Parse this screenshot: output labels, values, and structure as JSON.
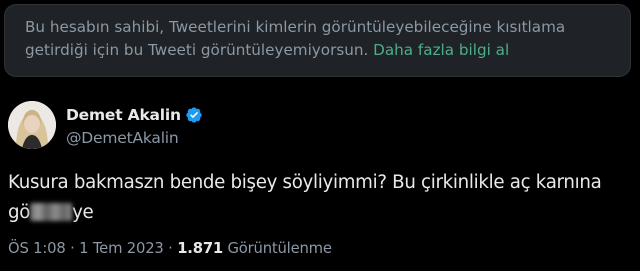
{
  "notice": {
    "line1": "Bu hesabın sahibi, Tweetlerini kimlerin görüntüleyebileceğine kısıtlama",
    "line2": "getirdiği için bu Tweeti görüntüleyemiyorsun.",
    "link": "Daha fazla bilgi al"
  },
  "tweet": {
    "author": {
      "display_name": "Demet Akalin",
      "handle": "@DemetAkalin",
      "verified": true,
      "avatar_icon": "profile-photo"
    },
    "text_line1": "Kusura bakmaszn bende bişey söyliyimmi? Bu çirkinlikle aç karnına",
    "text_line2_start": "gö",
    "text_line2_end": "ye",
    "time": "ÖS 1:08",
    "date": "1 Tem 2023",
    "separator": "·",
    "views_count": "1.871",
    "views_label": "Görüntülenme"
  },
  "colors": {
    "background": "#000000",
    "notice_bg": "#1f2226",
    "primary_text": "#e7e9ea",
    "secondary_text": "#8b98a5",
    "link": "#4caf88",
    "verified_blue": "#1d9bf0"
  }
}
